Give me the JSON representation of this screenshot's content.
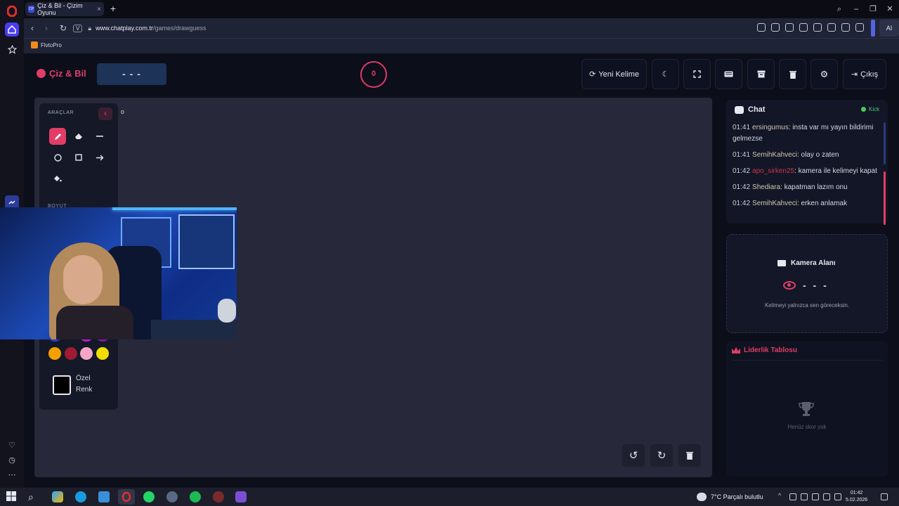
{
  "browser": {
    "tab_title": "Çiz & Bil - Çizim Oyunu",
    "tab_favicon": "CP",
    "vpn_badge": "V",
    "url_host": "www.chatplay.com.tr",
    "url_path": "/games/drawguess",
    "ai_label": "AI",
    "bookmark": "FlvtoPro"
  },
  "header": {
    "brand": "Çiz & Bil",
    "word_hint": "- - -",
    "score": "0",
    "new_word_label": "Yeni Kelime",
    "exit_label": "Çıkış",
    "accent_color": "#e13d67"
  },
  "tools": {
    "title": "ARAÇLAR",
    "size_label": "BOYUT",
    "custom_color_line1": "Özel",
    "custom_color_line2": "Renk",
    "swatches_visible": [
      "#f5a000",
      "#9e1b32",
      "#f4a6c6",
      "#f1de00"
    ]
  },
  "chat": {
    "title": "Chat",
    "platform": "Kick",
    "messages": [
      {
        "time": "01:41",
        "user": "ersingumus",
        "text": ": insta var mı yayın bildirimi gelmezse",
        "highlight": false
      },
      {
        "time": "01:41",
        "user": "SemihKahveci",
        "text": ": olay o zaten",
        "highlight": false
      },
      {
        "time": "01:42",
        "user": "apo_sirken25",
        "text": ": kamera ile kelimeyi kapat",
        "highlight": true
      },
      {
        "time": "01:42",
        "user": "Shediara",
        "text": ": kapatman lazım onu",
        "highlight": false
      },
      {
        "time": "01:42",
        "user": "SemihKahveci",
        "text": ": erken anlamak",
        "highlight": false
      }
    ]
  },
  "camera": {
    "title": "Kamera Alanı",
    "word": "- - -",
    "note": "Kelimeyi yalnızca sen göreceksin."
  },
  "leaderboard": {
    "title": "Liderlik Tablosu",
    "empty": "Henüz skor yok"
  },
  "taskbar": {
    "weather": "7°C  Parçalı bulutlu",
    "time": "01:42",
    "date": "5.02.2026"
  }
}
